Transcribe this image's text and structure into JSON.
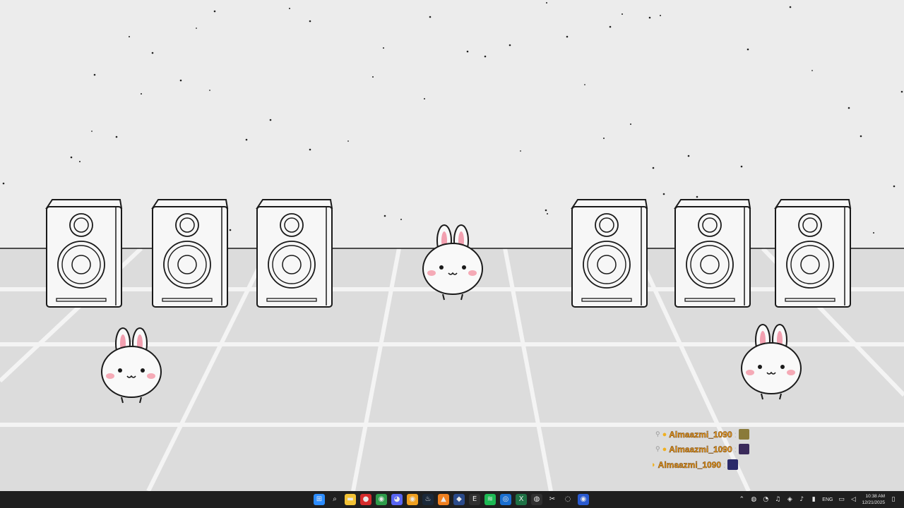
{
  "chat": {
    "messages": [
      {
        "user": "Almaazmi_1090",
        "separator": ":",
        "has_badge": true,
        "emote_color": "#8a7a3a"
      },
      {
        "user": "Almaazmi_1090",
        "separator": ":",
        "has_badge": true,
        "emote_color": "#3a2a5a"
      },
      {
        "user": "Almaazmi_1090",
        "separator": ":",
        "has_badge": false,
        "emote_color": "#2a2a6a"
      }
    ]
  },
  "taskbar": {
    "apps": [
      {
        "icon": "windows-start-icon",
        "color": "#2b8cff",
        "glyph": "⊞"
      },
      {
        "icon": "search-icon",
        "color": "transparent",
        "glyph": "⌕"
      },
      {
        "icon": "file-explorer-icon",
        "color": "#f3c235",
        "glyph": "▬"
      },
      {
        "icon": "screen-recorder-icon",
        "color": "#d62c2c",
        "glyph": "●"
      },
      {
        "icon": "chrome-icon",
        "color": "#2e9c4a",
        "glyph": "◉"
      },
      {
        "icon": "discord-icon",
        "color": "#5865f2",
        "glyph": "◕"
      },
      {
        "icon": "chrome-canary-icon",
        "color": "#f0a020",
        "glyph": "◉"
      },
      {
        "icon": "steam-icon",
        "color": "#1b2838",
        "glyph": "♨"
      },
      {
        "icon": "vlc-icon",
        "color": "#f08020",
        "glyph": "▲"
      },
      {
        "icon": "app-icon",
        "color": "#2a4a8a",
        "glyph": "◆"
      },
      {
        "icon": "epic-games-icon",
        "color": "#303030",
        "glyph": "E"
      },
      {
        "icon": "spotify-icon",
        "color": "#1db954",
        "glyph": "≋"
      },
      {
        "icon": "browser-icon",
        "color": "#1a6fd0",
        "glyph": "◎"
      },
      {
        "icon": "excel-icon",
        "color": "#1e7145",
        "glyph": "X"
      },
      {
        "icon": "obs-icon",
        "color": "#303030",
        "glyph": "◍"
      },
      {
        "icon": "capcut-icon",
        "color": "#1f1f1f",
        "glyph": "✂"
      },
      {
        "icon": "activity-icon",
        "color": "#1f1f1f",
        "glyph": "◌"
      },
      {
        "icon": "blue-app-icon",
        "color": "#2a5ad0",
        "glyph": "◉"
      }
    ],
    "tray": {
      "lang": "ENG",
      "time": "10:38 AM",
      "date": "12/21/2025"
    }
  }
}
